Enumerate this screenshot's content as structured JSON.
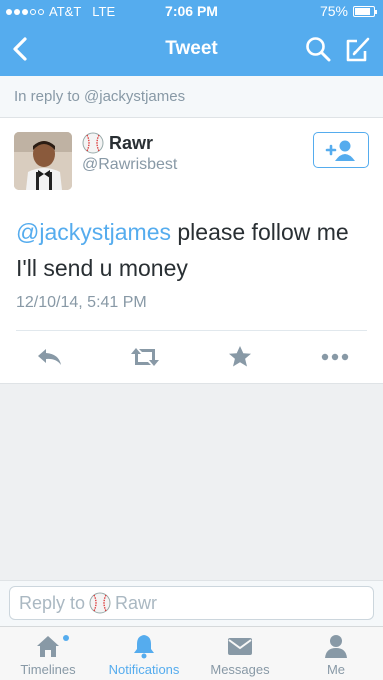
{
  "status_bar": {
    "carrier": "AT&T",
    "network": "LTE",
    "time": "7:06 PM",
    "battery_text": "75%",
    "battery_level": 0.75,
    "signal_bars_filled": 3,
    "signal_bars_total": 5
  },
  "navbar": {
    "title": "Tweet",
    "back_icon": "chevron-left-icon",
    "search_icon": "search-icon",
    "compose_icon": "compose-icon"
  },
  "reply_banner": {
    "text": "In reply to @jackystjames"
  },
  "tweet": {
    "author_name": "Rawr",
    "author_handle": "@Rawrisbest",
    "mention": "@jackystjames",
    "body": " please follow me I'll send u money",
    "timestamp": "12/10/14, 5:41 PM",
    "follow_icon": "add-user-icon",
    "actions": [
      "reply-icon",
      "retweet-icon",
      "favorite-icon",
      "more-icon"
    ]
  },
  "reply_box": {
    "prefix": "Reply to",
    "name": "Rawr"
  },
  "tabs": [
    {
      "label": "Timelines",
      "icon": "home-icon"
    },
    {
      "label": "Notifications",
      "icon": "bell-icon"
    },
    {
      "label": "Messages",
      "icon": "envelope-icon"
    },
    {
      "label": "Me",
      "icon": "person-icon"
    }
  ],
  "colors": {
    "brand": "#55acee",
    "text": "#292f33",
    "muted": "#8899a6",
    "icon_gray": "#8899a6"
  }
}
